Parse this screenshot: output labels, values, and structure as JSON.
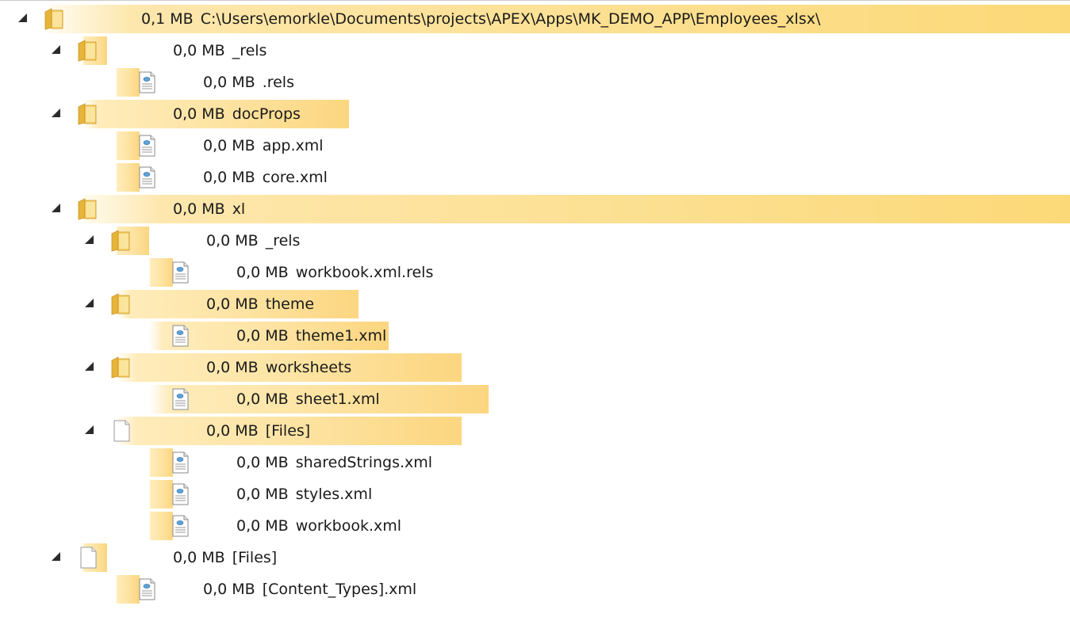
{
  "tree": {
    "rows": [
      {
        "size": "0,1 MB",
        "name": "C:\\Users\\emorkle\\Documents\\projects\\APEX\\Apps\\MK_DEMO_APP\\Employees_xlsx\\",
        "type": "folder",
        "expanded": true,
        "share": 1.0
      },
      {
        "size": "0,0 MB",
        "name": "_rels",
        "type": "folder",
        "expanded": true,
        "share": 0.05
      },
      {
        "size": "0,0 MB",
        "name": ".rels",
        "type": "file",
        "share": 0.05
      },
      {
        "size": "0,0 MB",
        "name": "docProps",
        "type": "folder",
        "expanded": true,
        "share": 0.2
      },
      {
        "size": "0,0 MB",
        "name": "app.xml",
        "type": "file",
        "share": 0.05
      },
      {
        "size": "0,0 MB",
        "name": "core.xml",
        "type": "file",
        "share": 0.05
      },
      {
        "size": "0,0 MB",
        "name": "xl",
        "type": "folder",
        "expanded": true,
        "share": 0.79
      },
      {
        "size": "0,0 MB",
        "name": "_rels",
        "type": "folder",
        "expanded": true,
        "share": 0.04
      },
      {
        "size": "0,0 MB",
        "name": "workbook.xml.rels",
        "type": "file",
        "share": 0.04
      },
      {
        "size": "0,0 MB",
        "name": "theme",
        "type": "folder",
        "expanded": true,
        "share": 0.37
      },
      {
        "size": "0,0 MB",
        "name": "theme1.xml",
        "type": "file",
        "share": 0.37
      },
      {
        "size": "0,0 MB",
        "name": "worksheets",
        "type": "folder",
        "expanded": true,
        "share": 0.57
      },
      {
        "size": "0,0 MB",
        "name": "sheet1.xml",
        "type": "file",
        "share": 0.57
      },
      {
        "size": "0,0 MB",
        "name": "[Files]",
        "type": "files",
        "expanded": true,
        "share": 0.57
      },
      {
        "size": "0,0 MB",
        "name": "sharedStrings.xml",
        "type": "file",
        "share": 0.05
      },
      {
        "size": "0,0 MB",
        "name": "styles.xml",
        "type": "file",
        "share": 0.05
      },
      {
        "size": "0,0 MB",
        "name": "workbook.xml",
        "type": "file",
        "share": 0.05
      },
      {
        "size": "0,0 MB",
        "name": "[Files]",
        "type": "files",
        "expanded": true,
        "share": 0.04
      },
      {
        "size": "0,0 MB",
        "name": "[Content_Types].xml",
        "type": "file",
        "share": 0.04
      }
    ]
  },
  "colors": {
    "bar": "#fcd680",
    "folder": "#f2c04a",
    "text": "#1a1a1a"
  }
}
